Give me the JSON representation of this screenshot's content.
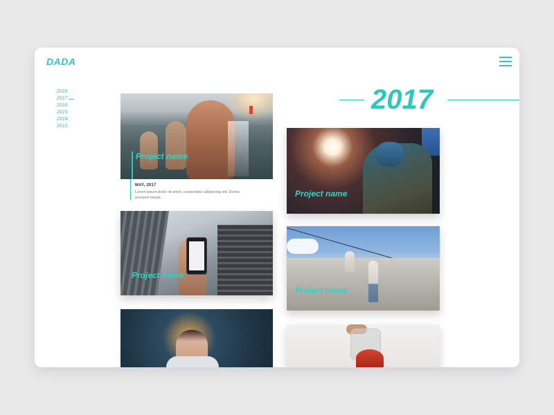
{
  "brand": {
    "logo": "DADA"
  },
  "nav": {
    "menu_icon": "hamburger-menu-icon"
  },
  "timeline": {
    "years": [
      "2018",
      "2017",
      "2016",
      "2015",
      "2014",
      "2013"
    ],
    "active": "2017"
  },
  "section": {
    "year": "2017"
  },
  "projects": [
    {
      "name": "Project name",
      "date": "MAY, 2017",
      "description": "Lorem ipsum dolor sit amet, consectetur adipiscing elit. Donec posuere neque."
    },
    {
      "name": "Project name"
    },
    {
      "name": "Project name"
    },
    {
      "name": "Project name"
    },
    {
      "name": ""
    },
    {
      "name": ""
    }
  ],
  "colors": {
    "accent": "#2cc8be",
    "background": "#e9e9ea",
    "card": "#ffffff"
  }
}
